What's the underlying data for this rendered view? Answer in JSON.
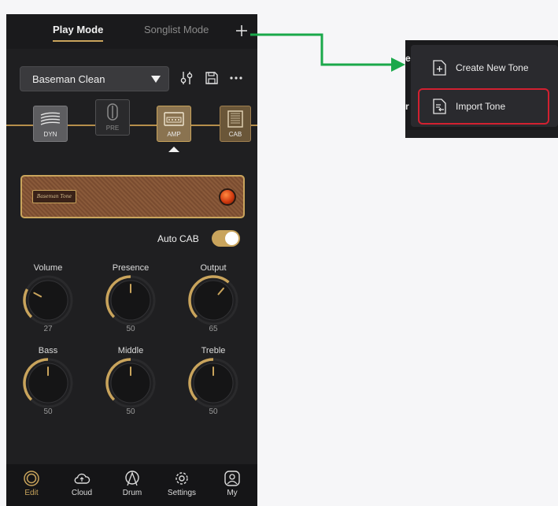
{
  "colors": {
    "accent": "#c9a45c",
    "arrow": "#1aa84a",
    "highlight": "#d22030",
    "background": "#1f1f21"
  },
  "header": {
    "tabs": [
      {
        "label": "Play Mode",
        "active": true
      },
      {
        "label": "Songlist Mode",
        "active": false
      }
    ],
    "add_icon": "plus-icon"
  },
  "tone": {
    "name": "Baseman Clean",
    "tools": [
      "eq-sliders-icon",
      "save-icon",
      "more-icon"
    ]
  },
  "chain": {
    "nodes": [
      {
        "label": "DYN",
        "icon": "dyn-icon"
      },
      {
        "label": "PRE",
        "icon": "pre-icon"
      },
      {
        "label": "AMP",
        "icon": "amp-icon",
        "selected": true
      },
      {
        "label": "CAB",
        "icon": "cab-icon"
      }
    ]
  },
  "amp": {
    "badge": "Baseman Tone"
  },
  "auto_cab": {
    "label": "Auto CAB",
    "on": true
  },
  "knobs": [
    {
      "label": "Volume",
      "value": "27"
    },
    {
      "label": "Presence",
      "value": "50"
    },
    {
      "label": "Output",
      "value": "65"
    },
    {
      "label": "Bass",
      "value": "50"
    },
    {
      "label": "Middle",
      "value": "50"
    },
    {
      "label": "Treble",
      "value": "50"
    }
  ],
  "nav": [
    {
      "label": "Edit",
      "icon": "edit-icon",
      "active": true
    },
    {
      "label": "Cloud",
      "icon": "cloud-icon"
    },
    {
      "label": "Drum",
      "icon": "drum-icon"
    },
    {
      "label": "Settings",
      "icon": "settings-icon"
    },
    {
      "label": "My",
      "icon": "user-icon"
    }
  ],
  "menu": {
    "items": [
      {
        "label": "Create New Tone",
        "icon": "create-file-icon"
      },
      {
        "label": "Import Tone",
        "icon": "import-file-icon",
        "highlighted": true
      }
    ]
  }
}
